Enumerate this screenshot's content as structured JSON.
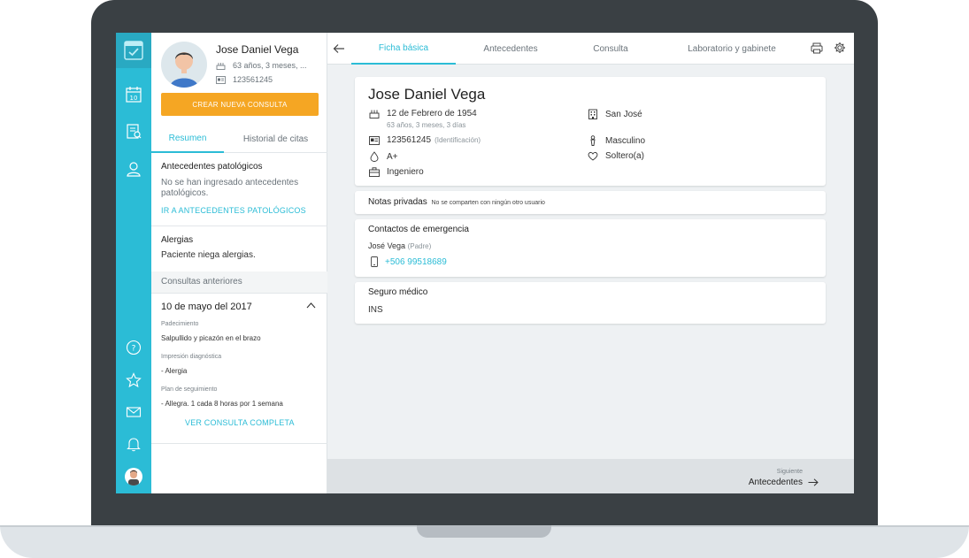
{
  "patient": {
    "name": "Jose Daniel Vega",
    "age_short": "63 años, 3 meses, ...",
    "id_number": "123561245"
  },
  "left_panel": {
    "create_button": "CREAR NUEVA CONSULTA",
    "tabs": [
      {
        "label": "Resumen",
        "active": true
      },
      {
        "label": "Historial de citas",
        "active": false
      }
    ],
    "antecedentes": {
      "title": "Antecedentes patológicos",
      "text": "No se han ingresado antecedentes patológicos.",
      "link": "IR A ANTECEDENTES PATOLÓGICOS"
    },
    "alergias": {
      "title": "Alergias",
      "text": "Paciente niega alergias."
    },
    "consultas_header": "Consultas anteriores",
    "consulta": {
      "date": "10 de mayo del 2017",
      "padecimiento_label": "Padecimiento",
      "padecimiento": "Salpullido y picazón en el brazo",
      "impresion_label": "Impresión diagnóstica",
      "impresion": "- Alergia",
      "plan_label": "Plan de seguimiento",
      "plan": "- Allegra. 1 cada 8 horas por 1 semana",
      "link": "VER CONSULTA COMPLETA"
    }
  },
  "main_tabs": [
    {
      "label": "Ficha básica",
      "active": true
    },
    {
      "label": "Antecedentes",
      "active": false
    },
    {
      "label": "Consulta",
      "active": false
    },
    {
      "label": "Laboratorio y gabinete",
      "active": false
    }
  ],
  "ficha": {
    "name": "Jose Daniel Vega",
    "birth": "12 de Febrero de 1954",
    "age_full": "63 años, 3 meses, 3 días",
    "id_number": "123561245",
    "id_label": "(Identificación)",
    "blood": "A+",
    "occupation": "Ingeniero",
    "location": "San José",
    "gender": "Masculino",
    "marital": "Soltero(a)"
  },
  "notes": {
    "title": "Notas privadas",
    "subtitle": "No se comparten con ningún otro usuario"
  },
  "emergency": {
    "title": "Contactos de emergencia",
    "contact_name": "José Vega",
    "relation": "(Padre)",
    "phone": "+506 99518689"
  },
  "insurance": {
    "title": "Seguro médico",
    "value": "INS"
  },
  "footer": {
    "small": "Siguiente",
    "next": "Antecedentes"
  },
  "colors": {
    "accent": "#2bbcd6",
    "cta": "#f5a623"
  },
  "icons": [
    "calendar-icon",
    "clipboard-icon",
    "profile-icon",
    "help-icon",
    "star-icon",
    "mail-icon",
    "bell-icon",
    "print-icon",
    "settings-icon",
    "back-arrow-icon"
  ]
}
